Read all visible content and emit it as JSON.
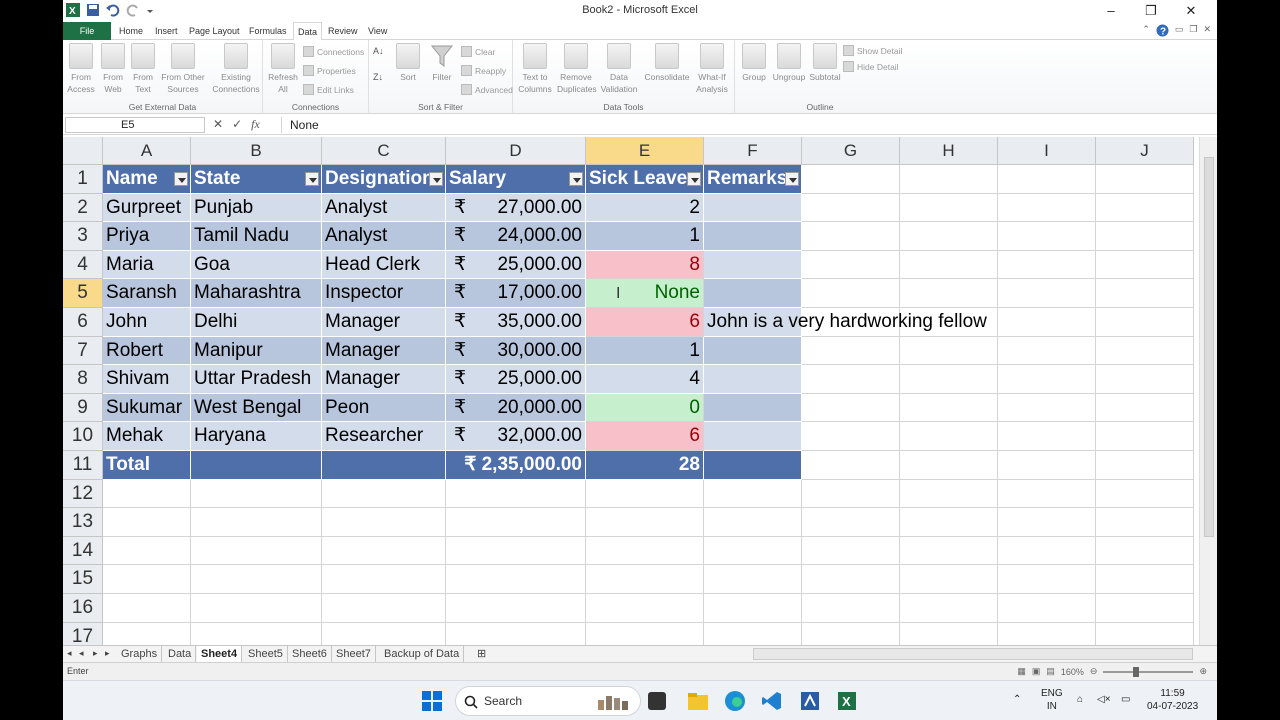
{
  "window": {
    "title": "Book2 - Microsoft Excel",
    "minimize": "–",
    "restore": "❐",
    "close": "✕"
  },
  "ribbon_tabs": [
    "File",
    "Home",
    "Insert",
    "Page Layout",
    "Formulas",
    "Data",
    "Review",
    "View"
  ],
  "active_tab": "Data",
  "ribbon": {
    "get_external": {
      "label": "Get External Data",
      "buttons": [
        "From Access",
        "From Web",
        "From Text",
        "From Other Sources"
      ],
      "existing": "Existing Connections"
    },
    "connections": {
      "label": "Connections",
      "refresh": "Refresh All",
      "items": [
        "Connections",
        "Properties",
        "Edit Links"
      ]
    },
    "sort_filter": {
      "label": "Sort & Filter",
      "sort": "Sort",
      "filter": "Filter",
      "items": [
        "Clear",
        "Reapply",
        "Advanced"
      ]
    },
    "data_tools": {
      "label": "Data Tools",
      "buttons": [
        "Text to Columns",
        "Remove Duplicates",
        "Data Validation",
        "Consolidate",
        "What-If Analysis"
      ]
    },
    "outline": {
      "label": "Outline",
      "buttons": [
        "Group",
        "Ungroup",
        "Subtotal"
      ],
      "items": [
        "Show Detail",
        "Hide Detail"
      ]
    }
  },
  "formula_bar": {
    "name_box": "E5",
    "fx": "fx",
    "value": "None"
  },
  "columns": [
    "A",
    "B",
    "C",
    "D",
    "E",
    "F",
    "G",
    "H",
    "I",
    "J"
  ],
  "selected_column": "E",
  "rows": [
    "1",
    "2",
    "3",
    "4",
    "5",
    "6",
    "7",
    "8",
    "9",
    "10",
    "11",
    "12",
    "13",
    "14",
    "15",
    "16",
    "17"
  ],
  "selected_row": "5",
  "table": {
    "headers": [
      "Name",
      "State",
      "Designation",
      "Salary",
      "Sick Leaves",
      "Remarks"
    ],
    "currency_symbol": "₹",
    "data": [
      {
        "name": "Gurpreet",
        "state": "Punjab",
        "designation": "Analyst",
        "salary": "27,000.00",
        "sick": "2",
        "remarks": ""
      },
      {
        "name": "Priya",
        "state": "Tamil Nadu",
        "designation": "Analyst",
        "salary": "24,000.00",
        "sick": "1",
        "remarks": ""
      },
      {
        "name": "Maria",
        "state": "Goa",
        "designation": "Head Clerk",
        "salary": "25,000.00",
        "sick": "8",
        "remarks": ""
      },
      {
        "name": "Saransh",
        "state": "Maharashtra",
        "designation": "Inspector",
        "salary": "17,000.00",
        "sick": "None",
        "remarks": ""
      },
      {
        "name": "John",
        "state": "Delhi",
        "designation": "Manager",
        "salary": "35,000.00",
        "sick": "6",
        "remarks": "John is a very hardworking fellow"
      },
      {
        "name": "Robert",
        "state": "Manipur",
        "designation": "Manager",
        "salary": "30,000.00",
        "sick": "1",
        "remarks": ""
      },
      {
        "name": "Shivam",
        "state": "Uttar Pradesh",
        "designation": "Manager",
        "salary": "25,000.00",
        "sick": "4",
        "remarks": ""
      },
      {
        "name": "Sukumar",
        "state": "West Bengal",
        "designation": "Peon",
        "salary": "20,000.00",
        "sick": "0",
        "remarks": ""
      },
      {
        "name": "Mehak",
        "state": "Haryana",
        "designation": "Researcher",
        "salary": "32,000.00",
        "sick": "6",
        "remarks": ""
      }
    ],
    "highlight": [
      "none",
      "none",
      "red",
      "green",
      "red",
      "none",
      "none",
      "green",
      "red"
    ],
    "total": {
      "label": "Total",
      "salary": "₹ 2,35,000.00",
      "sick": "28"
    }
  },
  "sheet_tabs": [
    "Graphs",
    "Data",
    "Sheet4",
    "Sheet5",
    "Sheet6",
    "Sheet7",
    "Backup of Data"
  ],
  "active_sheet": "Sheet4",
  "status": {
    "mode": "Enter",
    "zoom": "160%"
  },
  "taskbar": {
    "search_placeholder": "Search",
    "lang_top": "ENG",
    "lang_bottom": "IN",
    "time": "11:59",
    "date": "04-07-2023"
  },
  "colors": {
    "excel_green": "#1e7145",
    "table_header": "#4f6faa",
    "band_light": "#d3dcea",
    "band_dark": "#b7c6dc",
    "bad_fill": "#f8c0c8",
    "good_fill": "#c6efce",
    "selected_header": "#f9d98a"
  }
}
